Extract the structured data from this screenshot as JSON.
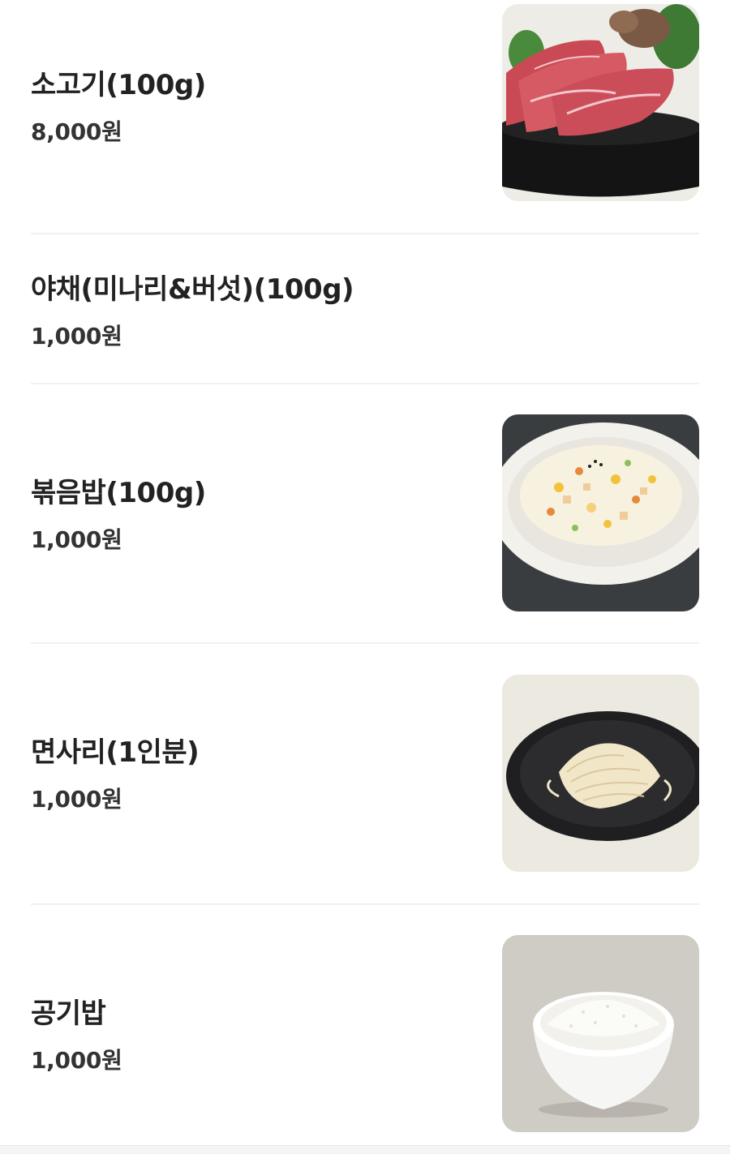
{
  "menu": {
    "items": [
      {
        "name": "소고기(100g)",
        "price": "8,000원",
        "image": "beef-photo"
      },
      {
        "name": "야채(미나리&버섯)(100g)",
        "price": "1,000원",
        "image": null
      },
      {
        "name": "볶음밥(100g)",
        "price": "1,000원",
        "image": "fried-rice-photo"
      },
      {
        "name": "면사리(1인분)",
        "price": "1,000원",
        "image": "noodles-photo"
      },
      {
        "name": "공기밥",
        "price": "1,000원",
        "image": "rice-bowl-photo"
      }
    ]
  },
  "colors": {
    "text_primary": "#222222",
    "text_price": "#333333",
    "divider": "#f0f0f0",
    "background": "#ffffff"
  }
}
